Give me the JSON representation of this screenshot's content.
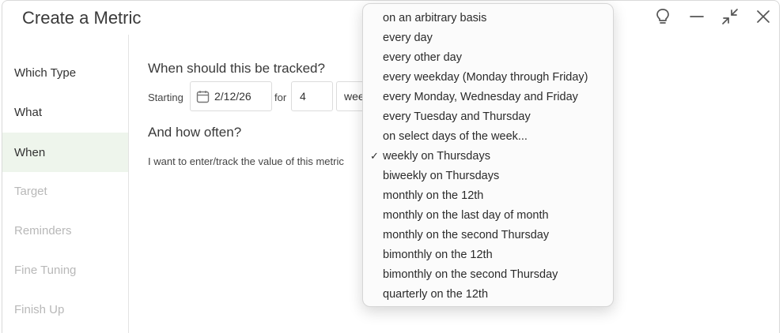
{
  "window": {
    "title": "Create a Metric"
  },
  "controls": [
    "lightbulb-icon",
    "minimize-icon",
    "collapse-icon",
    "close-icon"
  ],
  "sidebar": {
    "items": [
      {
        "label": "Which Type",
        "state": "enabled"
      },
      {
        "label": "What",
        "state": "enabled"
      },
      {
        "label": "When",
        "state": "active"
      },
      {
        "label": "Target",
        "state": "disabled"
      },
      {
        "label": "Reminders",
        "state": "disabled"
      },
      {
        "label": "Fine Tuning",
        "state": "disabled"
      },
      {
        "label": "Finish Up",
        "state": "disabled"
      }
    ]
  },
  "main": {
    "tracked_heading": "When should this be tracked?",
    "starting_label": "Starting",
    "start_date": "2/12/26",
    "for_label": "for",
    "duration_value": "4",
    "duration_unit_partial": "wee",
    "often_heading": "And how often?",
    "often_text": "I want to enter/track the value of this metric"
  },
  "dropdown": {
    "selected": "weekly on Thursdays",
    "options": [
      "on an arbitrary basis",
      "every day",
      "every other day",
      "every weekday (Monday through Friday)",
      "every Monday, Wednesday and Friday",
      "every Tuesday and Thursday",
      "on select days of the week...",
      "weekly on Thursdays",
      "biweekly on Thursdays",
      "monthly on the 12th",
      "monthly on the last day of month",
      "monthly on the second Thursday",
      "bimonthly on the 12th",
      "bimonthly on the second Thursday",
      "quarterly on the 12th"
    ]
  }
}
